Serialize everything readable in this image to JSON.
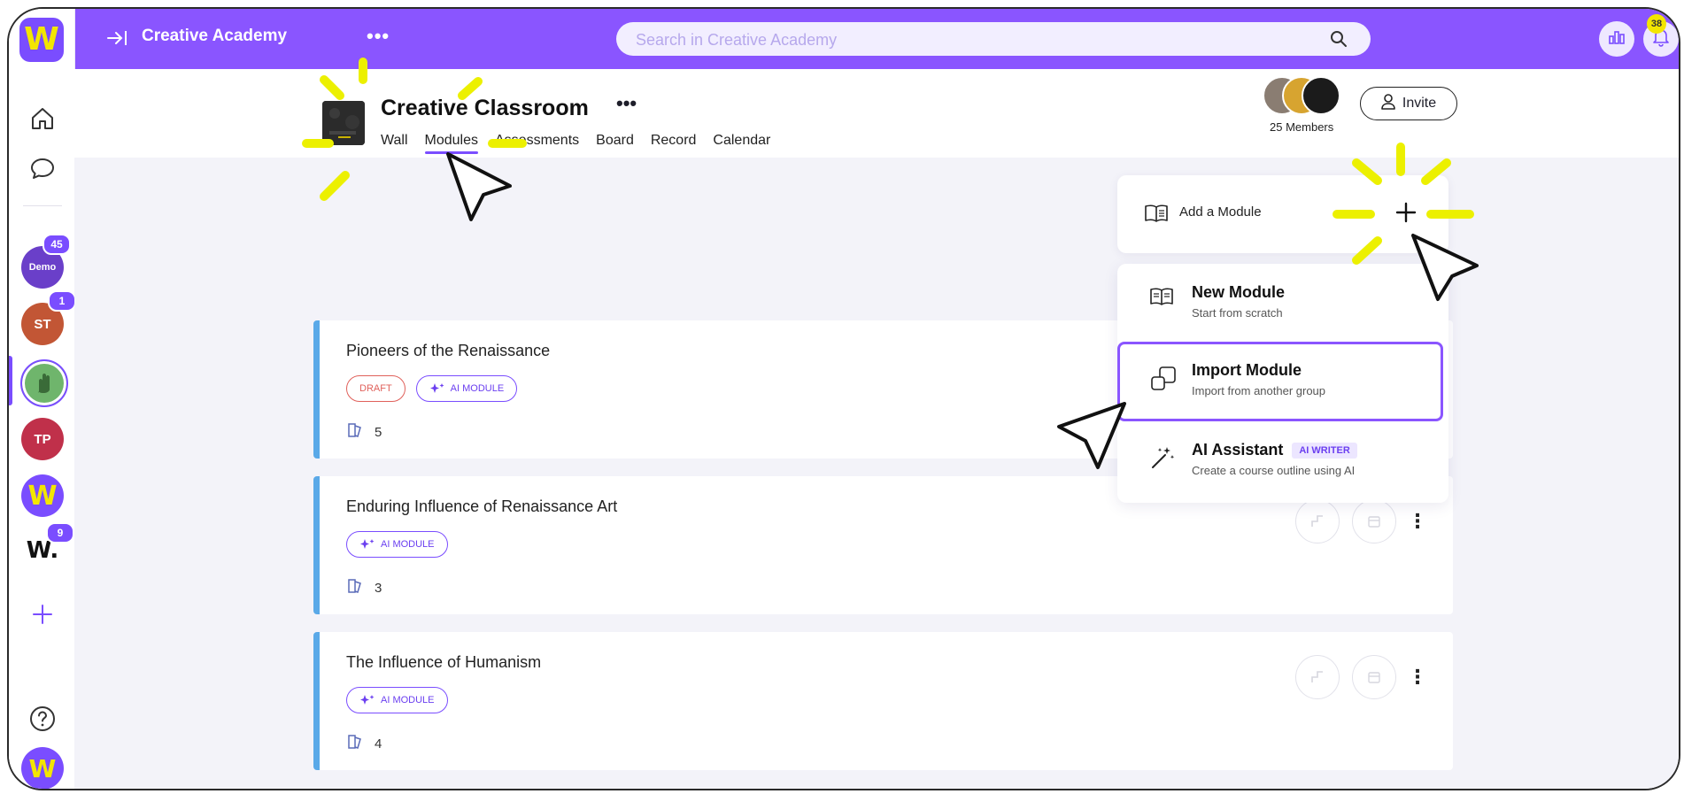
{
  "app": {
    "title": "Creative Academy",
    "search_placeholder": "Search in Creative Academy",
    "notification_count": "38"
  },
  "sidebar": {
    "groups": [
      {
        "label": "Demo",
        "badge": "45",
        "color": "#6a3fc9"
      },
      {
        "label": "ST",
        "badge": "1",
        "color": "#c25635"
      },
      {
        "label": "",
        "badge": "",
        "color": "#6fb56c"
      },
      {
        "label": "TP",
        "badge": "",
        "color": "#c0304a"
      },
      {
        "label": "W",
        "badge": "",
        "color": "#7a4dff"
      },
      {
        "label": "W.",
        "badge": "9",
        "color": "#ffffff"
      }
    ]
  },
  "header": {
    "class_title": "Creative Classroom",
    "tabs": [
      "Wall",
      "Modules",
      "Assessments",
      "Board",
      "Record",
      "Calendar"
    ],
    "active_tab": "Modules",
    "members_label": "25 Members",
    "invite_label": "Invite"
  },
  "add_module": {
    "label": "Add a Module"
  },
  "menu": {
    "items": [
      {
        "title": "New Module",
        "subtitle": "Start from scratch"
      },
      {
        "title": "Import Module",
        "subtitle": "Import from another group"
      },
      {
        "title": "AI Assistant",
        "badge": "AI WRITER",
        "subtitle": "Create a course outline using AI"
      }
    ]
  },
  "modules": [
    {
      "title": "Pioneers of the Renaissance",
      "tags": [
        "DRAFT",
        "AI MODULE"
      ],
      "count": "5"
    },
    {
      "title": "Enduring Influence of Renaissance Art",
      "tags": [
        "AI MODULE"
      ],
      "count": "3"
    },
    {
      "title": "The Influence of Humanism",
      "tags": [
        "AI MODULE"
      ],
      "count": "4"
    }
  ],
  "colors": {
    "brand": "#8a55ff",
    "accent_yellow": "#f3e600",
    "card_border": "#5aa9e8",
    "draft": "#e0615b"
  },
  "icons": [
    "collapse-icon",
    "more-icon",
    "search-icon",
    "chart-icon",
    "bell-icon",
    "home-icon",
    "chat-icon",
    "plus-icon",
    "help-icon",
    "book-icon",
    "import-icon",
    "magic-wand-icon",
    "lessons-icon",
    "path-icon",
    "calendar-icon",
    "kebab-icon",
    "user-icon",
    "sparkle-icon"
  ]
}
